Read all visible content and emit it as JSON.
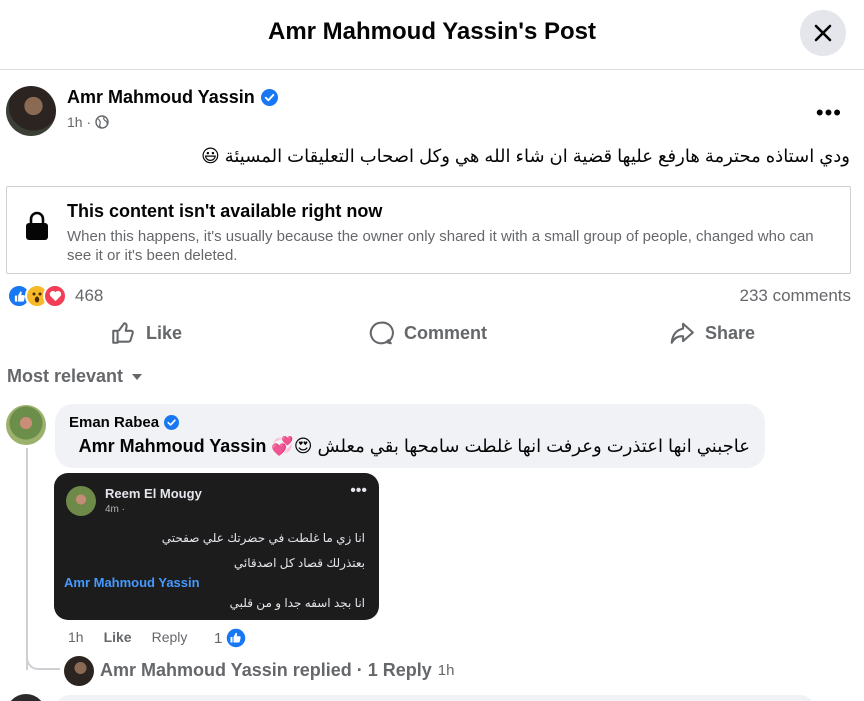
{
  "header": {
    "title": "Amr Mahmoud Yassin's Post"
  },
  "post": {
    "author": "Amr Mahmoud Yassin",
    "time": "1h ·",
    "text": "ودي استاذه محترمة  هارفع عليها قضية ان شاء الله  هي وكل اصحاب التعليقات  المسيئة 😃",
    "unavailable": {
      "title": "This content isn't available right now",
      "description": "When this happens, it's usually because the owner only shared it with a small group of people, changed who can see it or it's been deleted."
    },
    "reaction_count": "468",
    "comment_count": "233 comments",
    "actions": {
      "like": "Like",
      "comment": "Comment",
      "share": "Share"
    }
  },
  "sort": {
    "label": "Most relevant"
  },
  "comment": {
    "author": "Eman Rabea",
    "mention": "Amr Mahmoud Yassin",
    "text": "عاجبني انها اعتذرت وعرفت انها غلطت سامحها بقي معلش 😍💞",
    "attachment": {
      "name": "Reem El Mougy",
      "time": "4m ·",
      "line1": "انا زي ما غلطت في  حضرتك علي صفحتي",
      "line2": "بعتذرلك  قصاد كل اصدقائي",
      "mention": "Amr Mahmoud Yassin",
      "line3": "انا بجد اسفه جدا و من قلبي"
    },
    "time": "1h",
    "like_label": "Like",
    "reply_label": "Reply",
    "like_count": "1",
    "replies_summary": "Amr Mahmoud Yassin replied · 1 Reply",
    "replies_time": "1h"
  },
  "colors": {
    "accent": "#1877f2",
    "secondary_text": "#65676b",
    "bubble": "#f0f2f5"
  }
}
